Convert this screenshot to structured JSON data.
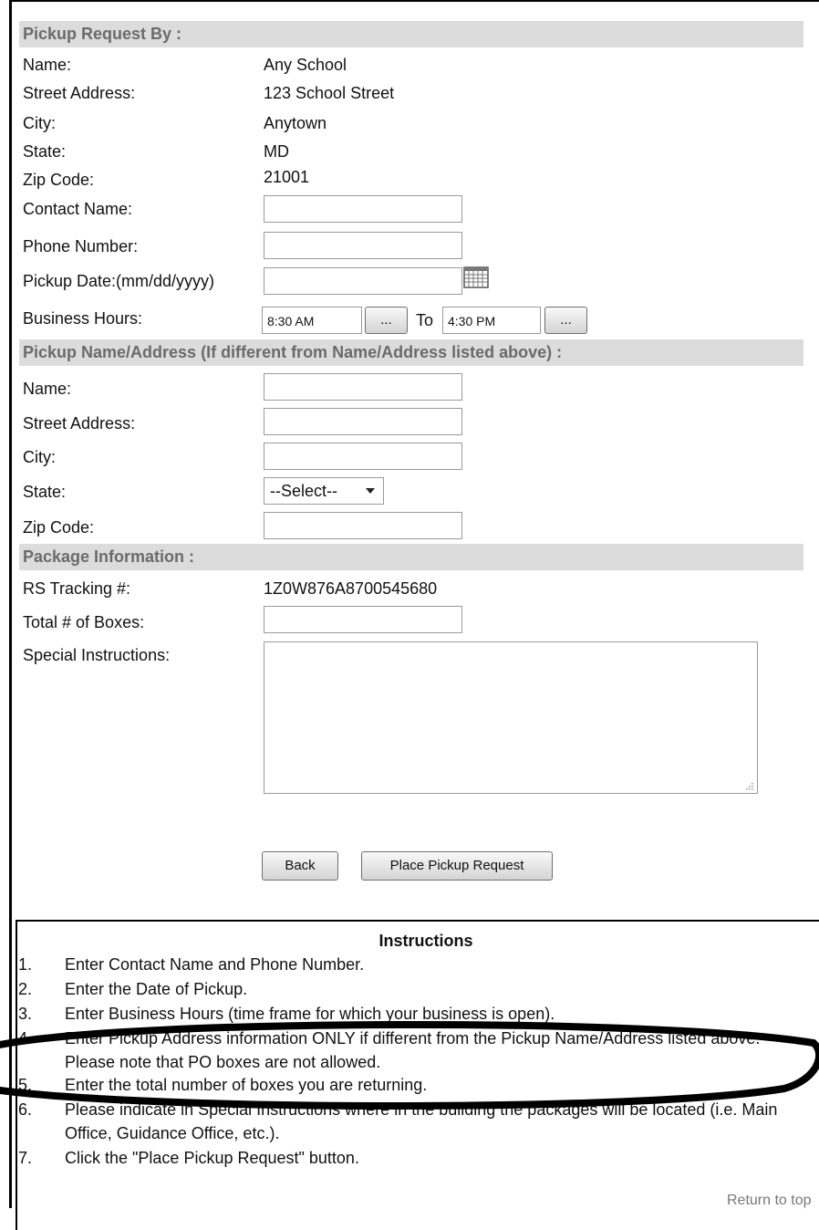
{
  "section_request": {
    "title": "Pickup Request By :"
  },
  "requester": {
    "name_label": "Name:",
    "name_value": "Any School",
    "street_label": "Street Address:",
    "street_value": "123 School Street",
    "city_label": "City:",
    "city_value": "Anytown",
    "state_label": "State:",
    "state_value": "MD",
    "zip_label": "Zip Code:",
    "zip_value": "21001",
    "contact_label": "Contact Name:",
    "contact_value": "",
    "phone_label": "Phone Number:",
    "phone_value": "",
    "date_label": "Pickup Date:(mm/dd/yyyy)",
    "date_value": "",
    "hours_label": "Business Hours:",
    "hours_from": "8:30 AM",
    "hours_to_label": "To",
    "hours_to": "4:30 PM",
    "picker_button_label": "..."
  },
  "section_pickup": {
    "title": "Pickup Name/Address (If different from Name/Address listed above) :"
  },
  "pickup": {
    "name_label": "Name:",
    "name_value": "",
    "street_label": "Street Address:",
    "street_value": "",
    "city_label": "City:",
    "city_value": "",
    "state_label": "State:",
    "state_selected": "--Select--",
    "zip_label": "Zip Code:",
    "zip_value": ""
  },
  "section_package": {
    "title": "Package Information :"
  },
  "package": {
    "tracking_label": "RS Tracking #:",
    "tracking_value": "1Z0W876A8700545680",
    "boxes_label": "Total # of Boxes:",
    "boxes_value": "",
    "instructions_label": "Special Instructions:",
    "instructions_value": ""
  },
  "actions": {
    "back_label": "Back",
    "submit_label": "Place Pickup Request"
  },
  "instructions": {
    "title": "Instructions",
    "items": [
      {
        "num": "1.",
        "text": "Enter Contact Name and Phone Number."
      },
      {
        "num": "2.",
        "text": "Enter the Date of Pickup."
      },
      {
        "num": "3.",
        "text": "Enter Business Hours (time frame for which your business is open)."
      },
      {
        "num": "4.",
        "text": "Enter Pickup Address information ONLY if different from the Pickup Name/Address listed above. Please note that PO boxes are not allowed."
      },
      {
        "num": "5.",
        "text": "Enter the total number of boxes you are returning."
      },
      {
        "num": "6.",
        "text": "Please indicate in Special Instructions where in the building the packages will be located (i.e. Main Office, Guidance Office, etc.)."
      },
      {
        "num": "7.",
        "text": "Click the \"Place Pickup Request\" button."
      }
    ],
    "return_link": "Return to top"
  },
  "colors": {
    "section_bg": "#dcdcdc",
    "section_text": "#6b6b6b",
    "highlight_ellipse": "#000000"
  },
  "icons": {
    "calendar": "calendar-icon",
    "dropdown": "chevron-down-icon",
    "resize": "resize-grip-icon"
  }
}
